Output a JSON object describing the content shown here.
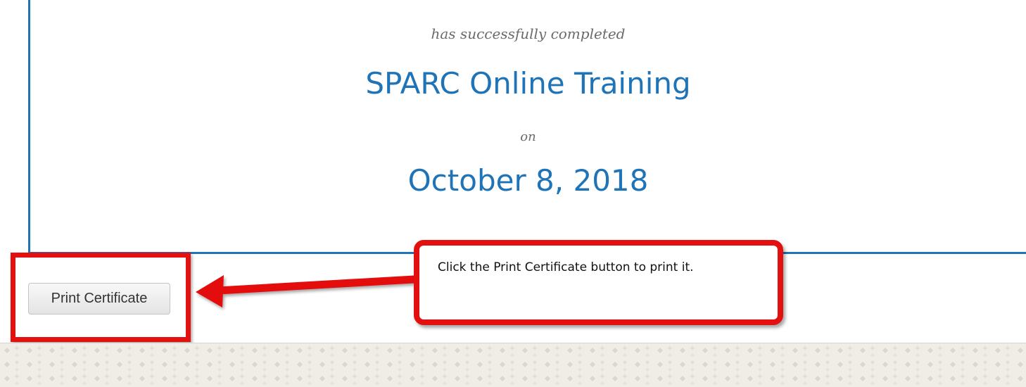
{
  "certificate": {
    "subtitle": "has successfully completed",
    "course_name": "SPARC Online Training",
    "on_text": "on",
    "date": "October 8, 2018"
  },
  "actions": {
    "print_label": "Print Certificate"
  },
  "annotation": {
    "callout_text": "Click the Print Certificate button to print it.",
    "highlight_color": "#e31010"
  },
  "colors": {
    "accent_blue": "#1f73b7",
    "footer_bg": "#f0ede6",
    "footer_pattern": "#dcd7cc"
  }
}
